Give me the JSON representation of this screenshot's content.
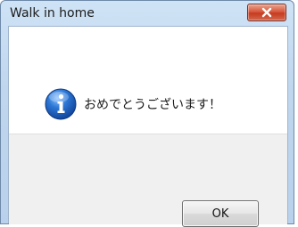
{
  "window": {
    "title": "Walk in home",
    "close_icon": "close-icon"
  },
  "dialog": {
    "icon": "info-icon",
    "message": "おめでとうございます！",
    "ok_label": "OK"
  },
  "colors": {
    "close_button": "#d04b2f",
    "info_icon": "#1e5fbf",
    "frame": "#b9d1ec"
  }
}
